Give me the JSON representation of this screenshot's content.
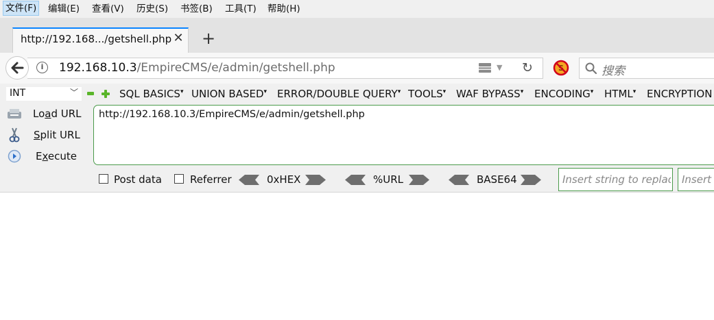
{
  "menubar": {
    "items": [
      {
        "label": "文件(F)"
      },
      {
        "label": "编辑(E)"
      },
      {
        "label": "查看(V)"
      },
      {
        "label": "历史(S)"
      },
      {
        "label": "书签(B)"
      },
      {
        "label": "工具(T)"
      },
      {
        "label": "帮助(H)"
      }
    ]
  },
  "tab": {
    "title": "http://192.168.../getshell.php",
    "close_glyph": "✕",
    "new_tab_glyph": "+"
  },
  "navbar": {
    "url_host": "192.168.10.3",
    "url_path": "/EmpireCMS/e/admin/getshell.php",
    "info_glyph": "i",
    "reload_glyph": "↻",
    "dropdown_glyph": "▼",
    "search_placeholder": "搜索"
  },
  "hackbar": {
    "select_value": "INT",
    "select_chevron": "﹀",
    "menus": [
      {
        "label": "SQL BASICS"
      },
      {
        "label": "UNION BASED"
      },
      {
        "label": "ERROR/DOUBLE QUERY"
      },
      {
        "label": "TOOLS"
      },
      {
        "label": "WAF BYPASS"
      },
      {
        "label": "ENCODING"
      },
      {
        "label": "HTML"
      },
      {
        "label": "ENCRYPTION"
      }
    ],
    "caret": "▾",
    "side_buttons": {
      "load_pre": "Lo",
      "load_ul": "a",
      "load_post": "d URL",
      "split_ul": "S",
      "split_post": "plit URL",
      "exec_pre": "E",
      "exec_ul": "x",
      "exec_post": "ecute"
    },
    "textarea_value": "http://192.168.10.3/EmpireCMS/e/admin/getshell.php",
    "post_data_label": "Post data",
    "referrer_label": "Referrer",
    "encoders": [
      {
        "label": "0xHEX"
      },
      {
        "label": "%URL"
      },
      {
        "label": "BASE64"
      }
    ],
    "replace_placeholder": "Insert string to replace",
    "replace_with_placeholder": "Insert replacing string"
  },
  "colors": {
    "accent": "#0a84ff",
    "hackbar_green": "#4a9a4a",
    "plus_green": "#5ab52a"
  },
  "icons": [
    "back-arrow-icon",
    "info-icon",
    "reader-icon",
    "reload-icon",
    "noscript-icon",
    "search-icon",
    "minus-icon",
    "plus-icon",
    "load-url-icon",
    "split-url-icon",
    "execute-icon"
  ]
}
